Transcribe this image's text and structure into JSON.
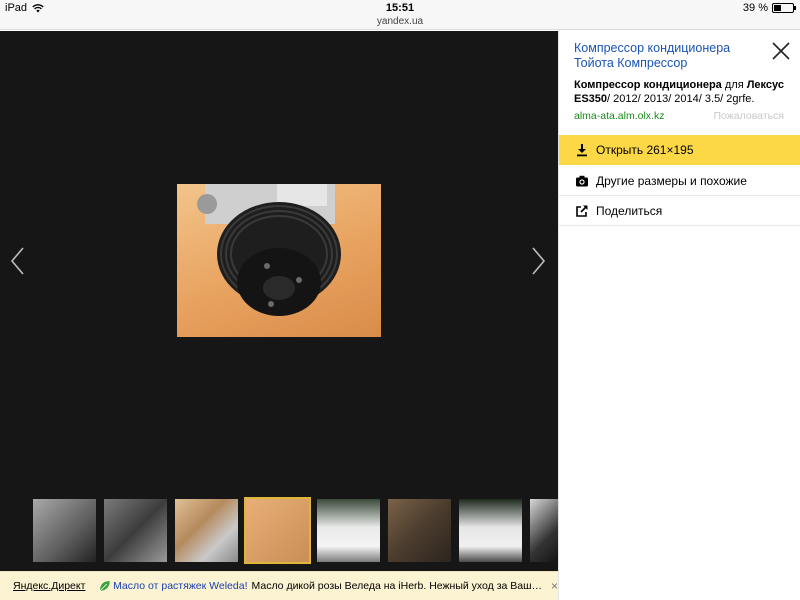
{
  "status_bar": {
    "device": "iPad",
    "time": "15:51",
    "url": "yandex.ua",
    "battery_text": "39 %",
    "battery_level": 0.39
  },
  "viewer": {
    "main_image_alt": "compressor-pulley-photo",
    "prev_icon": "chevron-left-icon",
    "next_icon": "chevron-right-icon",
    "thumbnails": [
      {
        "name": "thumb-1",
        "active": false
      },
      {
        "name": "thumb-2",
        "active": false
      },
      {
        "name": "thumb-3",
        "active": false
      },
      {
        "name": "thumb-4",
        "active": true
      },
      {
        "name": "thumb-5",
        "active": false
      },
      {
        "name": "thumb-6",
        "active": false
      },
      {
        "name": "thumb-7",
        "active": false
      },
      {
        "name": "thumb-8",
        "active": false
      }
    ]
  },
  "ad": {
    "source": "Яндекс.Директ",
    "title": "Масло от растяжек Weleda!",
    "text": "Масло дикой розы Веледа на iHerb. Нежный уход за Вашей к...",
    "close": "×",
    "leaf_color": "#3aa13a"
  },
  "panel": {
    "title": "Компрессор кондиционера Тойота Компрессор",
    "desc_bold_1": "Компрессор кондиционера",
    "desc_plain_1": " для ",
    "desc_bold_2": "Лексус ES350",
    "desc_plain_2": "/ 2012/ 2013/ 2014/ 3.5/ 2grfe.",
    "source": "alma-ata.alm.olx.kz",
    "report": "Пожаловаться",
    "actions": [
      {
        "label": "Открыть 261×195",
        "icon": "download-icon"
      },
      {
        "label": "Другие размеры и похожие",
        "icon": "camera-icon"
      },
      {
        "label": "Поделиться",
        "icon": "share-icon"
      }
    ]
  },
  "colors": {
    "accent_yellow": "#fcd847",
    "link_blue": "#1a53b5",
    "source_green": "#1a8a1a",
    "viewer_bg": "#161616"
  }
}
